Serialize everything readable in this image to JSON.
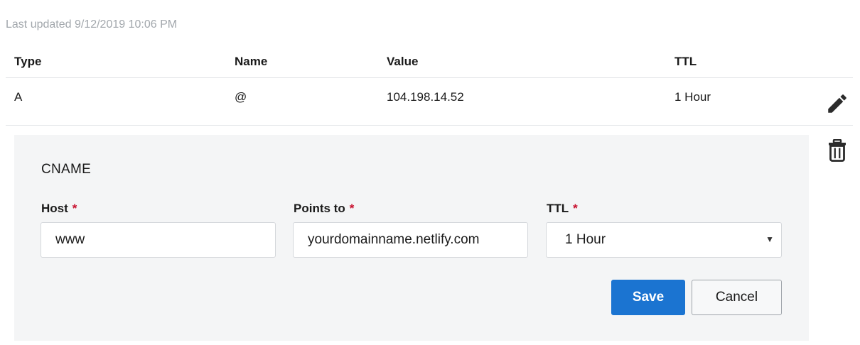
{
  "last_updated": "Last updated 9/12/2019 10:06 PM",
  "table": {
    "headers": {
      "type": "Type",
      "name": "Name",
      "value": "Value",
      "ttl": "TTL"
    },
    "rows": [
      {
        "type": "A",
        "name": "@",
        "value": "104.198.14.52",
        "ttl": "1 Hour"
      }
    ]
  },
  "row_actions": {
    "edit_icon": "pencil-icon",
    "delete_icon": "trash-icon"
  },
  "edit_panel": {
    "title": "CNAME",
    "host": {
      "label": "Host",
      "required_marker": "*",
      "value": "www"
    },
    "points_to": {
      "label": "Points to",
      "required_marker": "*",
      "value": "yourdomainname.netlify.com"
    },
    "ttl": {
      "label": "TTL",
      "required_marker": "*",
      "selected": "1 Hour"
    },
    "save_label": "Save",
    "cancel_label": "Cancel"
  },
  "colors": {
    "primary": "#1b74d1",
    "required": "#c8102e",
    "panel_bg": "#f4f5f6",
    "muted_text": "#a2a7ac"
  }
}
